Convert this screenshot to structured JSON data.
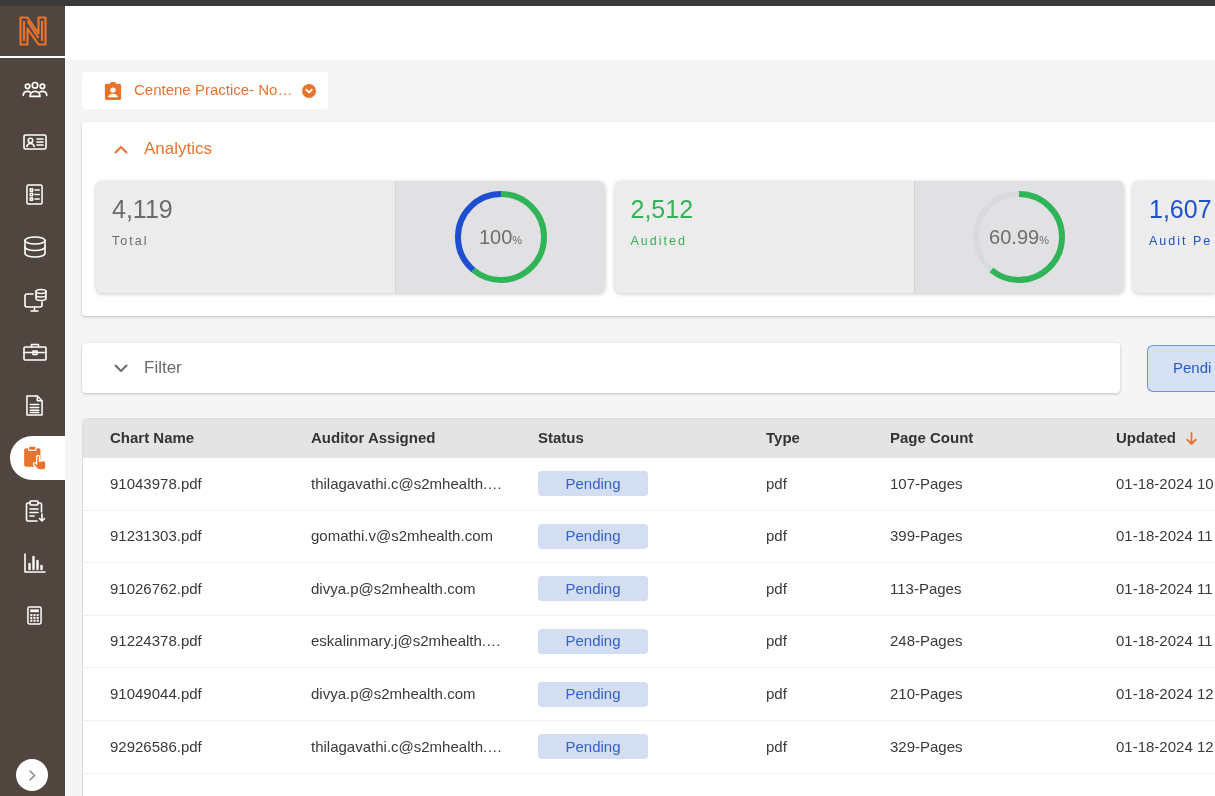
{
  "sidebar": {
    "items": [
      {
        "selected": false
      },
      {
        "selected": false
      },
      {
        "selected": false
      },
      {
        "selected": false
      },
      {
        "selected": false
      },
      {
        "selected": false
      },
      {
        "selected": false
      },
      {
        "selected": true
      },
      {
        "selected": false
      },
      {
        "selected": false
      },
      {
        "selected": false
      }
    ]
  },
  "practice_selector": {
    "label": "Centene Practice- No…"
  },
  "analytics": {
    "title": "Analytics",
    "expanded": true,
    "cards": [
      {
        "value": "4,119",
        "label": "Total",
        "color": "#6b6b6b",
        "ring": {
          "kind": "split",
          "level": 0.6099,
          "reading": "100",
          "unit": "%"
        }
      },
      {
        "value": "2,512",
        "label": "Audited",
        "color": "#34b157",
        "ring": {
          "kind": "progress",
          "level": 0.6099,
          "reading": "60.99",
          "unit": "%"
        }
      },
      {
        "value": "1,607",
        "label": "Audit Pe",
        "color": "#1f4fc9"
      }
    ]
  },
  "filter": {
    "title": "Filter",
    "expanded": false
  },
  "status_button": {
    "label": "Pendi"
  },
  "table": {
    "columns": [
      {
        "label": "Chart Name",
        "sorted": false
      },
      {
        "label": "Auditor Assigned",
        "sorted": false
      },
      {
        "label": "Status",
        "sorted": false
      },
      {
        "label": "Type",
        "sorted": false
      },
      {
        "label": "Page Count",
        "sorted": false
      },
      {
        "label": "Updated",
        "sorted": true
      }
    ],
    "rows": [
      {
        "chart_name": "91043978.pdf",
        "auditor": "thilagavathi.c@s2mhealth.…",
        "status": "Pending",
        "type": "pdf",
        "page_count": "107-Pages",
        "updated": "01-18-2024 10"
      },
      {
        "chart_name": "91231303.pdf",
        "auditor": "gomathi.v@s2mhealth.com",
        "status": "Pending",
        "type": "pdf",
        "page_count": "399-Pages",
        "updated": "01-18-2024 11"
      },
      {
        "chart_name": "91026762.pdf",
        "auditor": "divya.p@s2mhealth.com",
        "status": "Pending",
        "type": "pdf",
        "page_count": "113-Pages",
        "updated": "01-18-2024 11"
      },
      {
        "chart_name": "91224378.pdf",
        "auditor": "eskalinmary.j@s2mhealth.…",
        "status": "Pending",
        "type": "pdf",
        "page_count": "248-Pages",
        "updated": "01-18-2024 11"
      },
      {
        "chart_name": "91049044.pdf",
        "auditor": "divya.p@s2mhealth.com",
        "status": "Pending",
        "type": "pdf",
        "page_count": "210-Pages",
        "updated": "01-18-2024 12"
      },
      {
        "chart_name": "92926586.pdf",
        "auditor": "thilagavathi.c@s2mhealth.…",
        "status": "Pending",
        "type": "pdf",
        "page_count": "329-Pages",
        "updated": "01-18-2024 12"
      }
    ]
  }
}
